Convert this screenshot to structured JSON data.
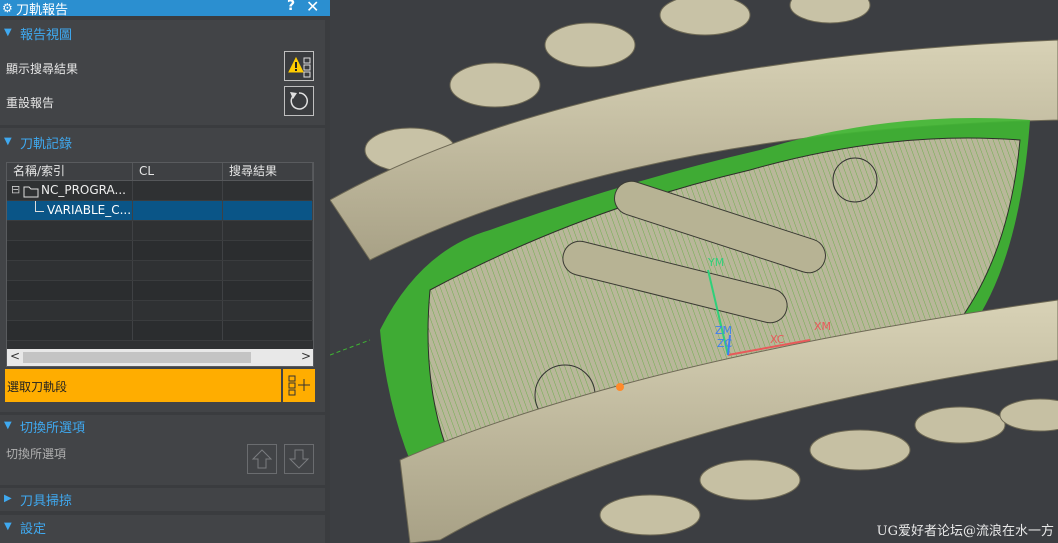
{
  "window": {
    "title": "刀軌報告",
    "help": "?",
    "close": "✕"
  },
  "report_view": {
    "header": "報告視圖",
    "show_results_label": "顯示搜尋結果",
    "reset_label": "重設報告"
  },
  "toolpath_records": {
    "header": "刀軌記錄",
    "columns": [
      "名稱/索引",
      "CL",
      "搜尋結果"
    ],
    "tree": [
      {
        "label": "NC_PROGRA...",
        "level": 0,
        "selected": false
      },
      {
        "label": "VARIABLE_C...",
        "level": 1,
        "selected": true
      }
    ],
    "scroll_left": "<",
    "scroll_right": ">",
    "select_segment_label": "選取刀軌段"
  },
  "switch_options": {
    "header": "切換所選項",
    "label": "切換所選項"
  },
  "tool_sweep": {
    "header": "刀具掃掠"
  },
  "settings": {
    "header": "設定"
  },
  "viewport": {
    "labels": {
      "ym": "YM",
      "zm": "ZM",
      "zc": "ZC",
      "xc": "XC",
      "xm": "XM"
    },
    "watermark": "UG爱好者论坛@流浪在水一方"
  },
  "colors": {
    "accent": "#2b8fd0",
    "header_text": "#3fa9f0",
    "select_button": "#ffad00",
    "selected_row": "#0a5587",
    "toolpath": "#3cc02a",
    "part": "#c9c3a6"
  }
}
